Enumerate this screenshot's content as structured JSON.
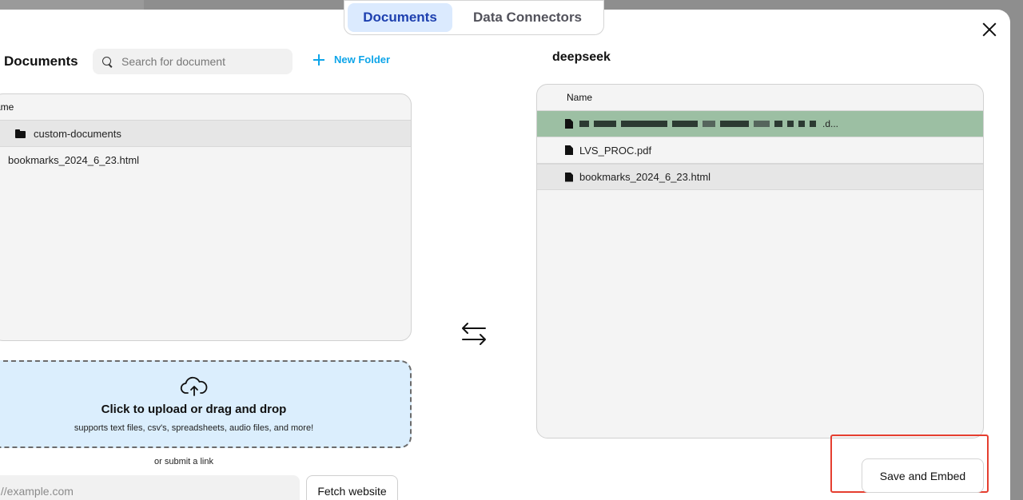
{
  "tabs": [
    {
      "label": "Documents",
      "active": true
    },
    {
      "label": "Data Connectors",
      "active": false
    }
  ],
  "left": {
    "title": "Documents",
    "search_placeholder": "Search for document",
    "new_folder_label": "New Folder",
    "column_header": "ame",
    "items": [
      {
        "type": "folder",
        "name": "custom-documents",
        "selected": true
      },
      {
        "type": "file",
        "name": "bookmarks_2024_6_23.html",
        "selected": false
      }
    ]
  },
  "upload": {
    "title": "Click to upload or drag and drop",
    "subtitle": "supports text files, csv's, spreadsheets, audio files, and more!",
    "or_link": "or submit a link",
    "url_placeholder": "://example.com",
    "fetch_label": "Fetch website"
  },
  "right": {
    "workspace_name": "deepseek",
    "column_header": "Name",
    "items": [
      {
        "type": "file",
        "name": "[redacted] .d...",
        "state": "highlighted-green"
      },
      {
        "type": "file",
        "name": "LVS_PROC.pdf",
        "state": "normal"
      },
      {
        "type": "file",
        "name": "bookmarks_2024_6_23.html",
        "state": "selected"
      }
    ],
    "redacted_suffix": ".d..."
  },
  "save_label": "Save and Embed",
  "icons": {
    "close": "close-icon",
    "search": "search-icon",
    "new_folder": "plus-icon",
    "folder": "folder-icon",
    "file": "file-icon",
    "upload": "cloud-upload-icon",
    "swap": "swap-arrows-icon"
  },
  "colors": {
    "accent_blue": "#0ea5e9",
    "active_tab_bg": "#dbeafe",
    "active_tab_text": "#1e40af",
    "upload_bg": "#dbeefd",
    "row_green": "#9cbfa3",
    "highlight_red": "#e53e2f"
  }
}
